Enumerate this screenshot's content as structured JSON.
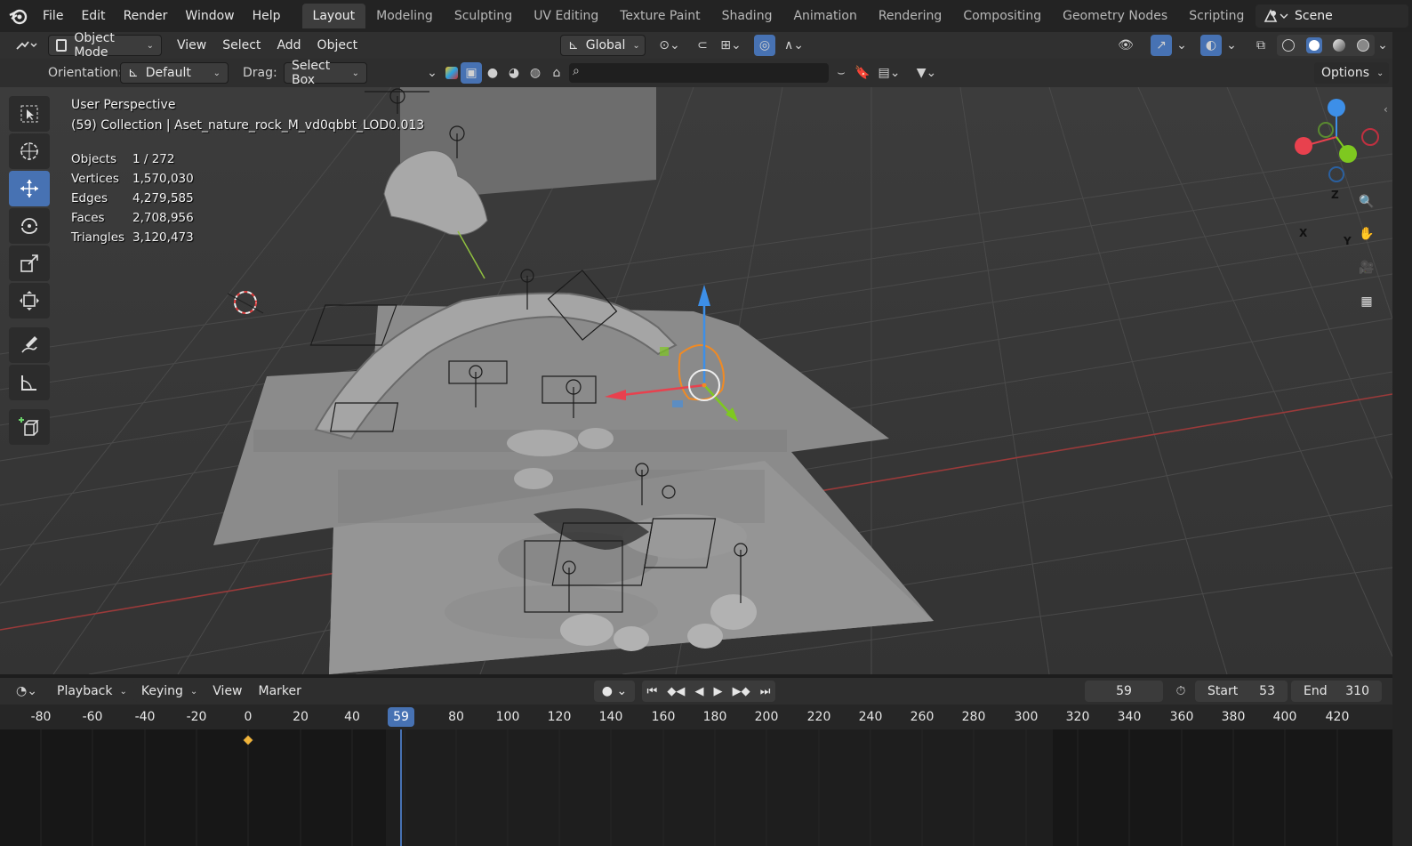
{
  "menu": {
    "items": [
      "File",
      "Edit",
      "Render",
      "Window",
      "Help"
    ]
  },
  "workspaces": {
    "tabs": [
      "Layout",
      "Modeling",
      "Sculpting",
      "UV Editing",
      "Texture Paint",
      "Shading",
      "Animation",
      "Rendering",
      "Compositing",
      "Geometry Nodes",
      "Scripting"
    ],
    "active": "Layout",
    "plus": "+"
  },
  "scene": {
    "name": "Scene"
  },
  "header": {
    "mode": "Object Mode",
    "view": "View",
    "select": "Select",
    "add": "Add",
    "object": "Object",
    "transform_orientation": "Global"
  },
  "tool_settings": {
    "orientation_label": "Orientation:",
    "orientation_value": "Default",
    "drag_label": "Drag:",
    "drag_value": "Select Box",
    "options": "Options"
  },
  "viewport": {
    "perspective": "User Perspective",
    "collection_info": "(59) Collection | Aset_nature_rock_M_vd0qbbt_LOD0.013",
    "stats": [
      {
        "label": "Objects",
        "value": "1 / 272"
      },
      {
        "label": "Vertices",
        "value": "1,570,030"
      },
      {
        "label": "Edges",
        "value": "4,279,585"
      },
      {
        "label": "Faces",
        "value": "2,708,956"
      },
      {
        "label": "Triangles",
        "value": "3,120,473"
      }
    ],
    "gizmo": {
      "x": "X",
      "y": "Y",
      "z": "Z"
    }
  },
  "timeline": {
    "playback": "Playback",
    "keying": "Keying",
    "view": "View",
    "marker": "Marker",
    "current_frame": "59",
    "start_label": "Start",
    "start_value": "53",
    "end_label": "End",
    "end_value": "310",
    "ticks": [
      "-80",
      "-60",
      "-40",
      "-20",
      "0",
      "20",
      "40",
      "59",
      "80",
      "100",
      "120",
      "140",
      "160",
      "180",
      "200",
      "220",
      "240",
      "260",
      "280",
      "300",
      "320",
      "340",
      "360",
      "380",
      "400",
      "420"
    ]
  },
  "colors": {
    "accent": "#4772b3",
    "x_axis": "#e8414e",
    "y_axis": "#7ec820",
    "z_axis": "#3d8fe8",
    "selection": "#f08a24"
  }
}
